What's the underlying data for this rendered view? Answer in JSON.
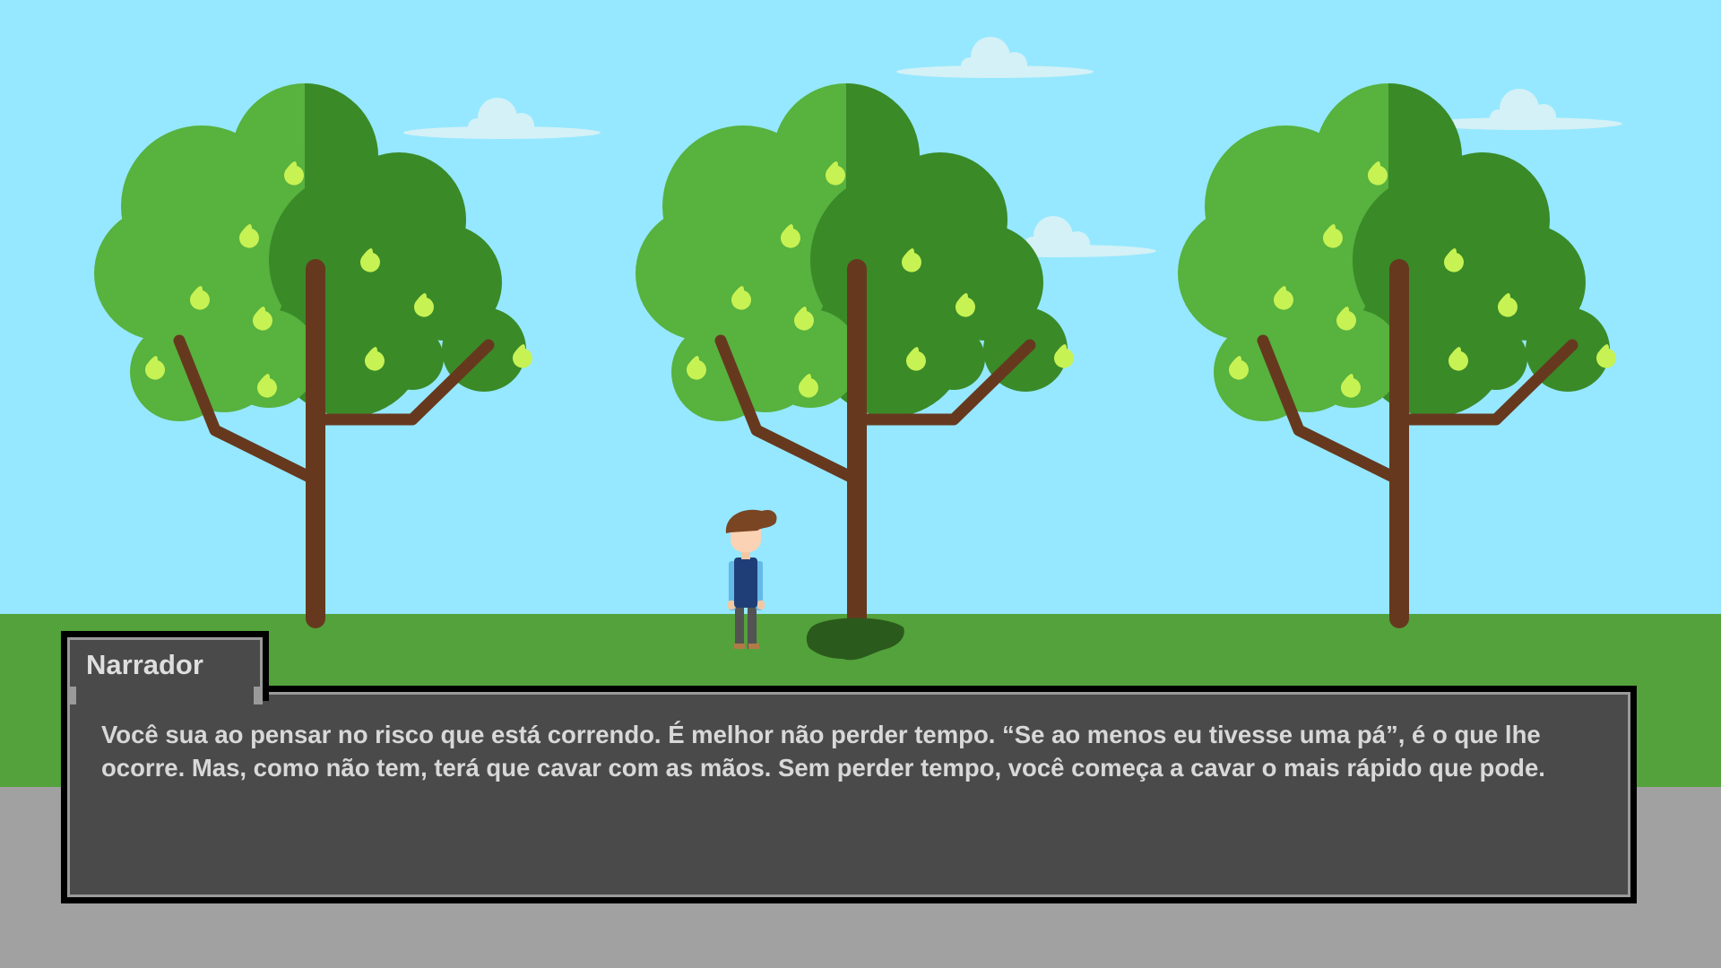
{
  "dialogue": {
    "speaker": "Narrador",
    "text": "Você sua ao pensar no risco que está correndo. É melhor não perder tempo. “Se ao menos eu tivesse uma pá”, é o que lhe ocorre. Mas, como não tem, terá que cavar com as mãos. Sem perder tempo, você começa a cavar o mais rápido que pode."
  },
  "colors": {
    "sky": "#95e8ff",
    "grass": "#53a23b",
    "road": "#a1a1a1",
    "tree_light": "#57b23e",
    "tree_dark": "#3a8a28",
    "trunk": "#66391f",
    "fruit": "#c7f253",
    "hole": "#2b5a1d",
    "dialog_bg": "#4a4a4a",
    "dialog_border": "#9a9a9a",
    "dialog_text": "#d8d8d8"
  },
  "scene": {
    "trees": [
      {
        "name": "tree-left"
      },
      {
        "name": "tree-center"
      },
      {
        "name": "tree-right"
      }
    ],
    "clouds": 4,
    "character": "boy",
    "hole": "dug-hole"
  }
}
